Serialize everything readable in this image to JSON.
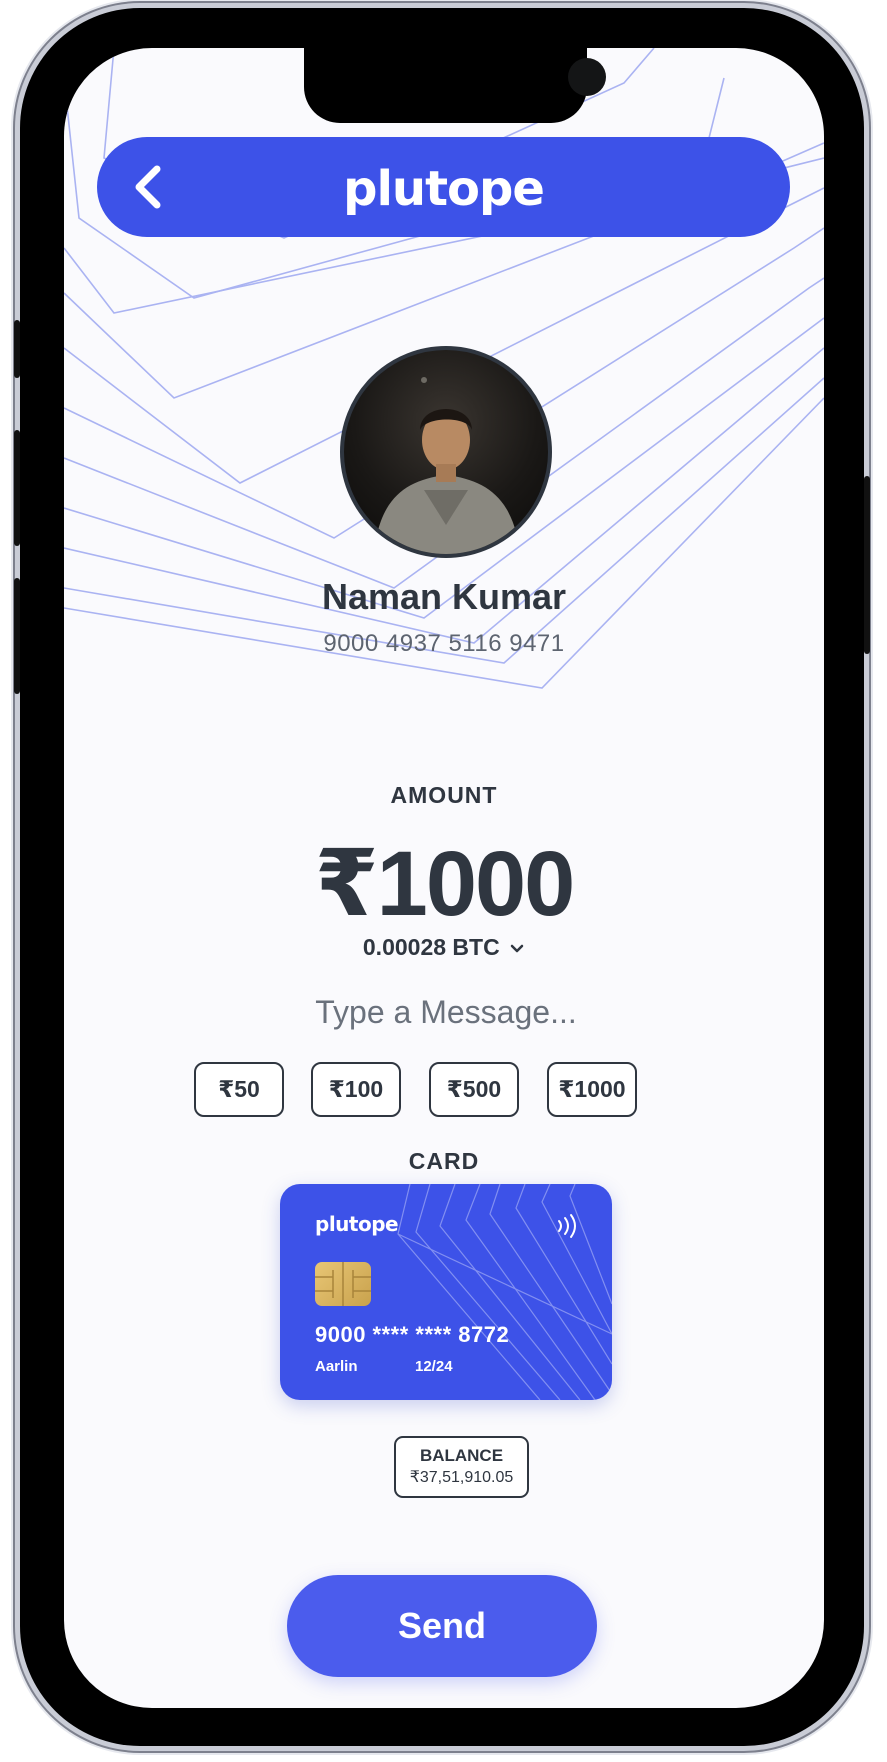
{
  "header": {
    "brand": "plutope",
    "back_icon": "chevron-left-icon"
  },
  "recipient": {
    "name": "Naman Kumar",
    "number": "9000 4937 5116 9471"
  },
  "amount": {
    "label": "AMOUNT",
    "value": "₹1000",
    "btc": "0.00028 BTC",
    "btc_icon": "chevron-down-icon"
  },
  "message": {
    "placeholder": "Type a Message..."
  },
  "quick_amounts": [
    "₹50",
    "₹100",
    "₹500",
    "₹1000"
  ],
  "card": {
    "label": "CARD",
    "brand": "plutope",
    "number": "9000 **** **** 8772",
    "holder": "Aarlin",
    "expiry": "12/24",
    "icons": [
      "contactless-icon",
      "chip-icon"
    ]
  },
  "balance": {
    "label": "BALANCE",
    "value": "₹37,51,910.05"
  },
  "send": {
    "label": "Send"
  },
  "colors": {
    "accent": "#3d52e8",
    "button": "#4b5ced",
    "text": "#2f3640",
    "background": "#fafafd"
  }
}
